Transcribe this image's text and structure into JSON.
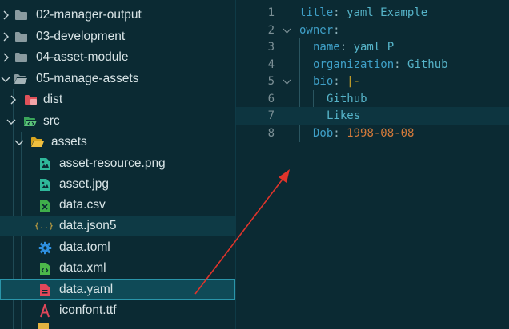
{
  "explorer": {
    "items": [
      {
        "label": "02-manager-output"
      },
      {
        "label": "03-development"
      },
      {
        "label": "04-asset-module"
      },
      {
        "label": "05-manage-assets"
      },
      {
        "label": "dist"
      },
      {
        "label": "src"
      },
      {
        "label": "assets"
      },
      {
        "label": "asset-resource.png"
      },
      {
        "label": "asset.jpg"
      },
      {
        "label": "data.csv"
      },
      {
        "label": "data.json5"
      },
      {
        "label": "data.toml"
      },
      {
        "label": "data.xml"
      },
      {
        "label": "data.yaml"
      },
      {
        "label": "iconfont.ttf"
      }
    ],
    "json_icon_glyph": "{..}"
  },
  "editor": {
    "lines": [
      {
        "num": "1",
        "key": "title",
        "sep": ": ",
        "val": "yaml Example"
      },
      {
        "num": "2",
        "key": "owner",
        "sep": ":",
        "val": ""
      },
      {
        "num": "3",
        "key": "name",
        "sep": ": ",
        "val": "yaml P"
      },
      {
        "num": "4",
        "key": "organization",
        "sep": ": ",
        "val": "Github"
      },
      {
        "num": "5",
        "key": "bio",
        "sep": ": ",
        "val": "|-"
      },
      {
        "num": "6",
        "key": "",
        "sep": "",
        "val": "Github"
      },
      {
        "num": "7",
        "key": "",
        "sep": "",
        "val": "Likes"
      },
      {
        "num": "8",
        "key": "Dob",
        "sep": ": ",
        "val": "1998-08-08"
      }
    ]
  },
  "colors": {
    "accent": "#2a95aa",
    "arrow": "#e0342b",
    "date": "#d47a3a"
  }
}
